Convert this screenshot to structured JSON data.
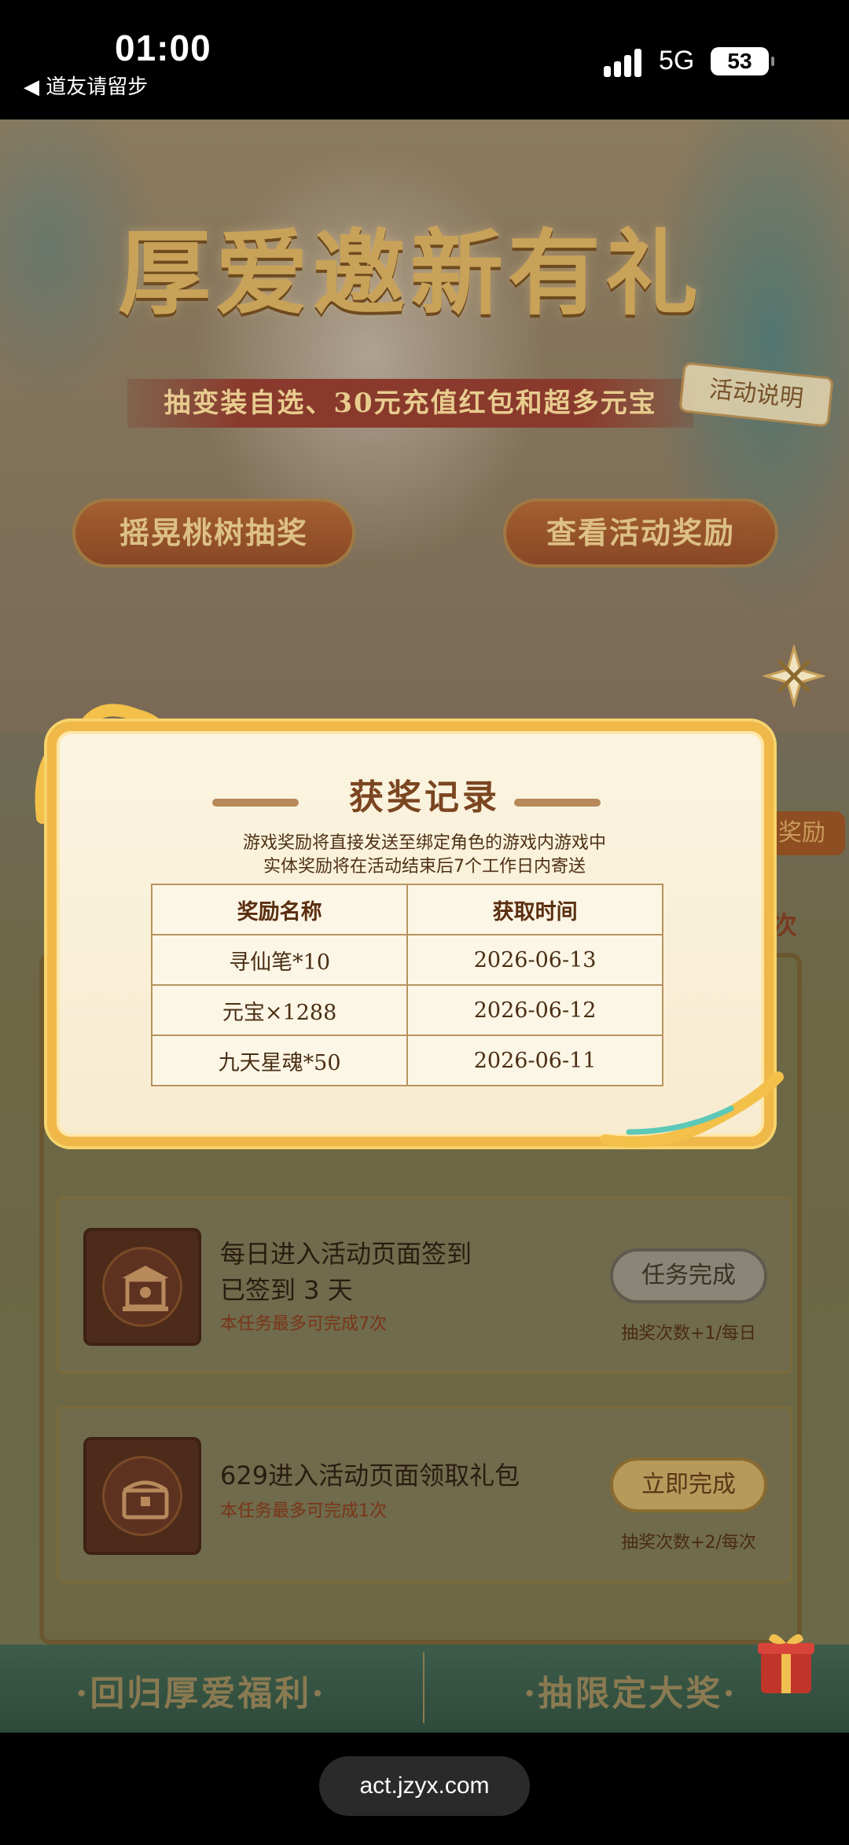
{
  "status_bar": {
    "time": "01:00",
    "back_app": "◀ 道友请留步",
    "network": "5G",
    "battery": "53"
  },
  "hero": {
    "title": "厚爱邀新有礼",
    "subtitle": "抽变装自选、30元充值红包和超多元宝",
    "activity_note": "活动说明",
    "btn_shake": "摇晃桃树抽奖",
    "btn_view_rewards": "查看活动奖励"
  },
  "side": {
    "tag": "奖励",
    "count": "次"
  },
  "modal": {
    "title": "获奖记录",
    "note_line1": "游戏奖励将直接发送至绑定角色的游戏内游戏中",
    "note_line2": "实体奖励将在活动结束后7个工作日内寄送",
    "columns": [
      "奖励名称",
      "获取时间"
    ],
    "rows": [
      {
        "name": "寻仙笔*10",
        "time": "2026-06-13"
      },
      {
        "name": "元宝×1288",
        "time": "2026-06-12"
      },
      {
        "name": "九天星魂*50",
        "time": "2026-06-11"
      }
    ]
  },
  "tasks": [
    {
      "title_line1": "每日进入活动页面签到",
      "title_line2": "已签到 3 天",
      "limit": "本任务最多可完成7次",
      "button": "任务完成",
      "reward": "抽奖次数+1/每日"
    },
    {
      "title_line1": "629进入活动页面领取礼包",
      "limit": "本任务最多可完成1次",
      "button": "立即完成",
      "reward": "抽奖次数+2/每次"
    }
  ],
  "bottom_banner": {
    "left": "·回归厚爱福利·",
    "right": "·抽限定大奖·"
  },
  "address_bar": {
    "url": "act.jzyx.com"
  },
  "colors": {
    "modal_border": "#f0b848",
    "modal_bg": "#fbf4e0",
    "title_brown": "#7a4520",
    "table_border": "#b7945e"
  },
  "icons": [
    "signal-icon",
    "battery-icon",
    "close-icon",
    "shrine-icon",
    "treasure-chest-icon",
    "gift-box-icon"
  ]
}
